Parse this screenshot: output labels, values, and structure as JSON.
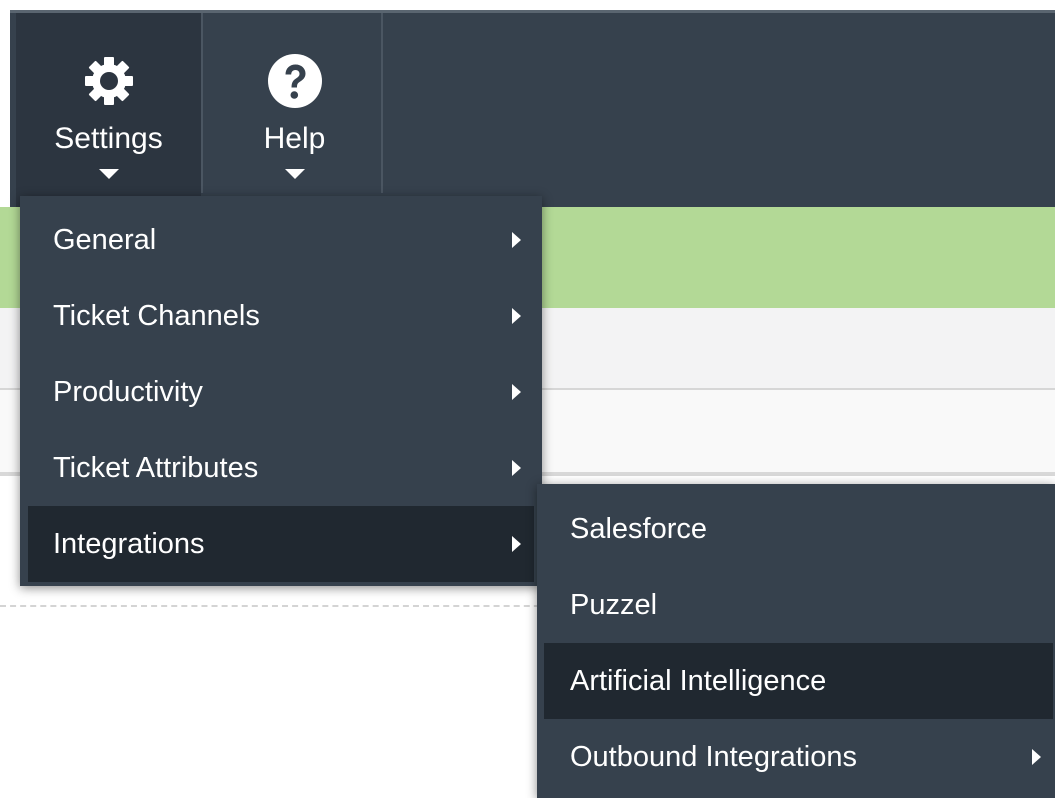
{
  "colors": {
    "nav_bg": "#36414d",
    "nav_active_bg": "#2c3540",
    "menu_bg": "#36414d",
    "menu_active_bg": "#202830",
    "banner_green": "#b3d996",
    "text": "#ffffff"
  },
  "nav": {
    "settings": {
      "label": "Settings",
      "icon": "gear-icon"
    },
    "help": {
      "label": "Help",
      "icon": "question-circle-icon"
    }
  },
  "settings_menu": {
    "items": [
      {
        "label": "General",
        "has_submenu": true,
        "active": false
      },
      {
        "label": "Ticket Channels",
        "has_submenu": true,
        "active": false
      },
      {
        "label": "Productivity",
        "has_submenu": true,
        "active": false
      },
      {
        "label": "Ticket Attributes",
        "has_submenu": true,
        "active": false
      },
      {
        "label": "Integrations",
        "has_submenu": true,
        "active": true
      }
    ]
  },
  "integrations_menu": {
    "items": [
      {
        "label": "Salesforce",
        "has_submenu": false,
        "active": false
      },
      {
        "label": "Puzzel",
        "has_submenu": false,
        "active": false
      },
      {
        "label": "Artificial Intelligence",
        "has_submenu": false,
        "active": true
      },
      {
        "label": "Outbound Integrations",
        "has_submenu": true,
        "active": false
      }
    ]
  }
}
